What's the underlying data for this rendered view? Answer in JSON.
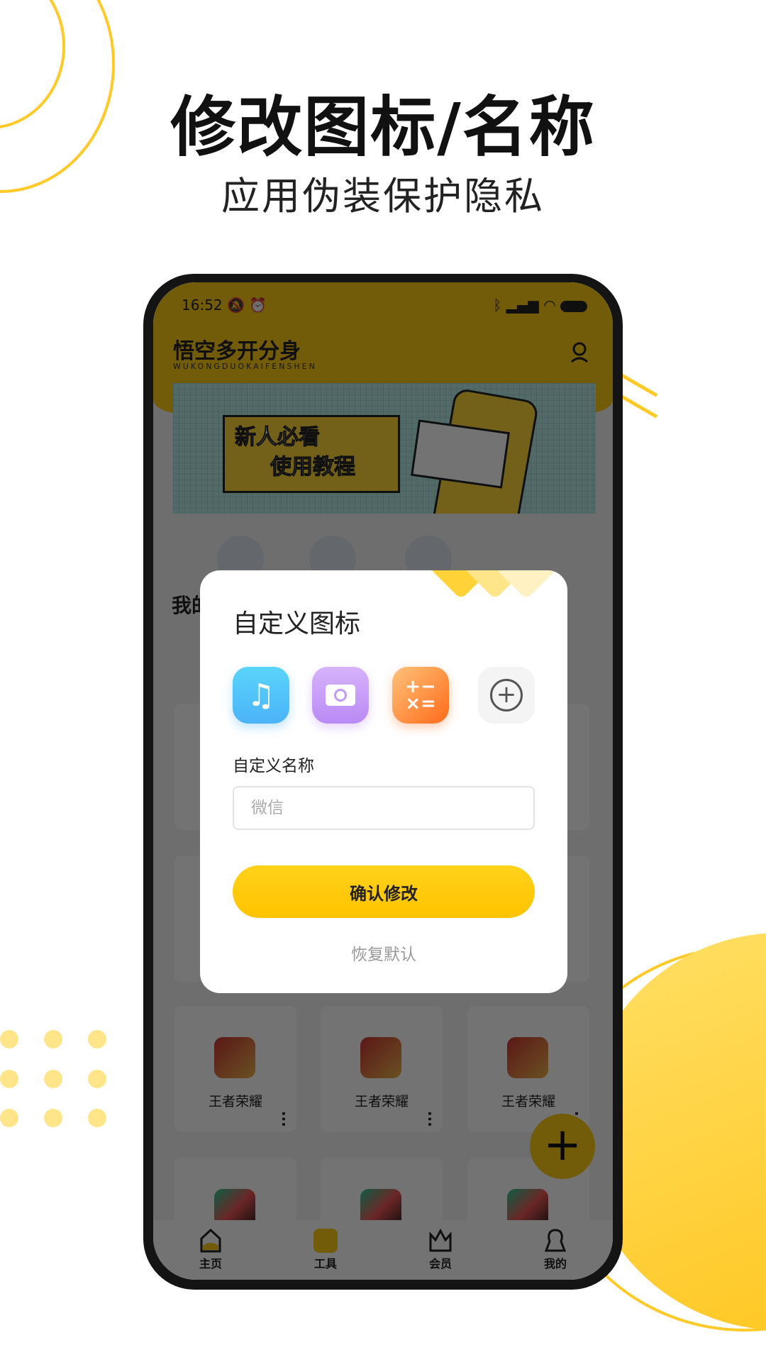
{
  "hero": {
    "title": "修改图标/名称",
    "subtitle": "应用伪装保护隐私"
  },
  "status_bar": {
    "time": "16:52",
    "icons": [
      "mute-icon",
      "alarm-icon",
      "bluetooth-icon",
      "signal-icon",
      "wifi-icon",
      "battery-icon"
    ]
  },
  "app": {
    "title": "悟空多开分身",
    "subtitle": "WUKONGDUOKAIFENSHEN"
  },
  "banner": {
    "line1": "新人必看",
    "line2": "使用教程"
  },
  "section_title": "我的",
  "apps": [
    {
      "name": "王者荣耀"
    },
    {
      "name": "王者荣耀"
    },
    {
      "name": "王者荣耀"
    }
  ],
  "nav": [
    {
      "label": "主页"
    },
    {
      "label": "工具",
      "active": true
    },
    {
      "label": "会员"
    },
    {
      "label": "我的"
    }
  ],
  "dialog": {
    "title": "自定义图标",
    "icons": [
      "music-icon",
      "camera-icon",
      "calculator-icon",
      "add-icon"
    ],
    "name_label": "自定义名称",
    "name_placeholder": "微信",
    "confirm": "确认修改",
    "reset": "恢复默认"
  },
  "colors": {
    "accent": "#FDCB13",
    "overlay": "rgba(0,0,0,0.6)"
  }
}
